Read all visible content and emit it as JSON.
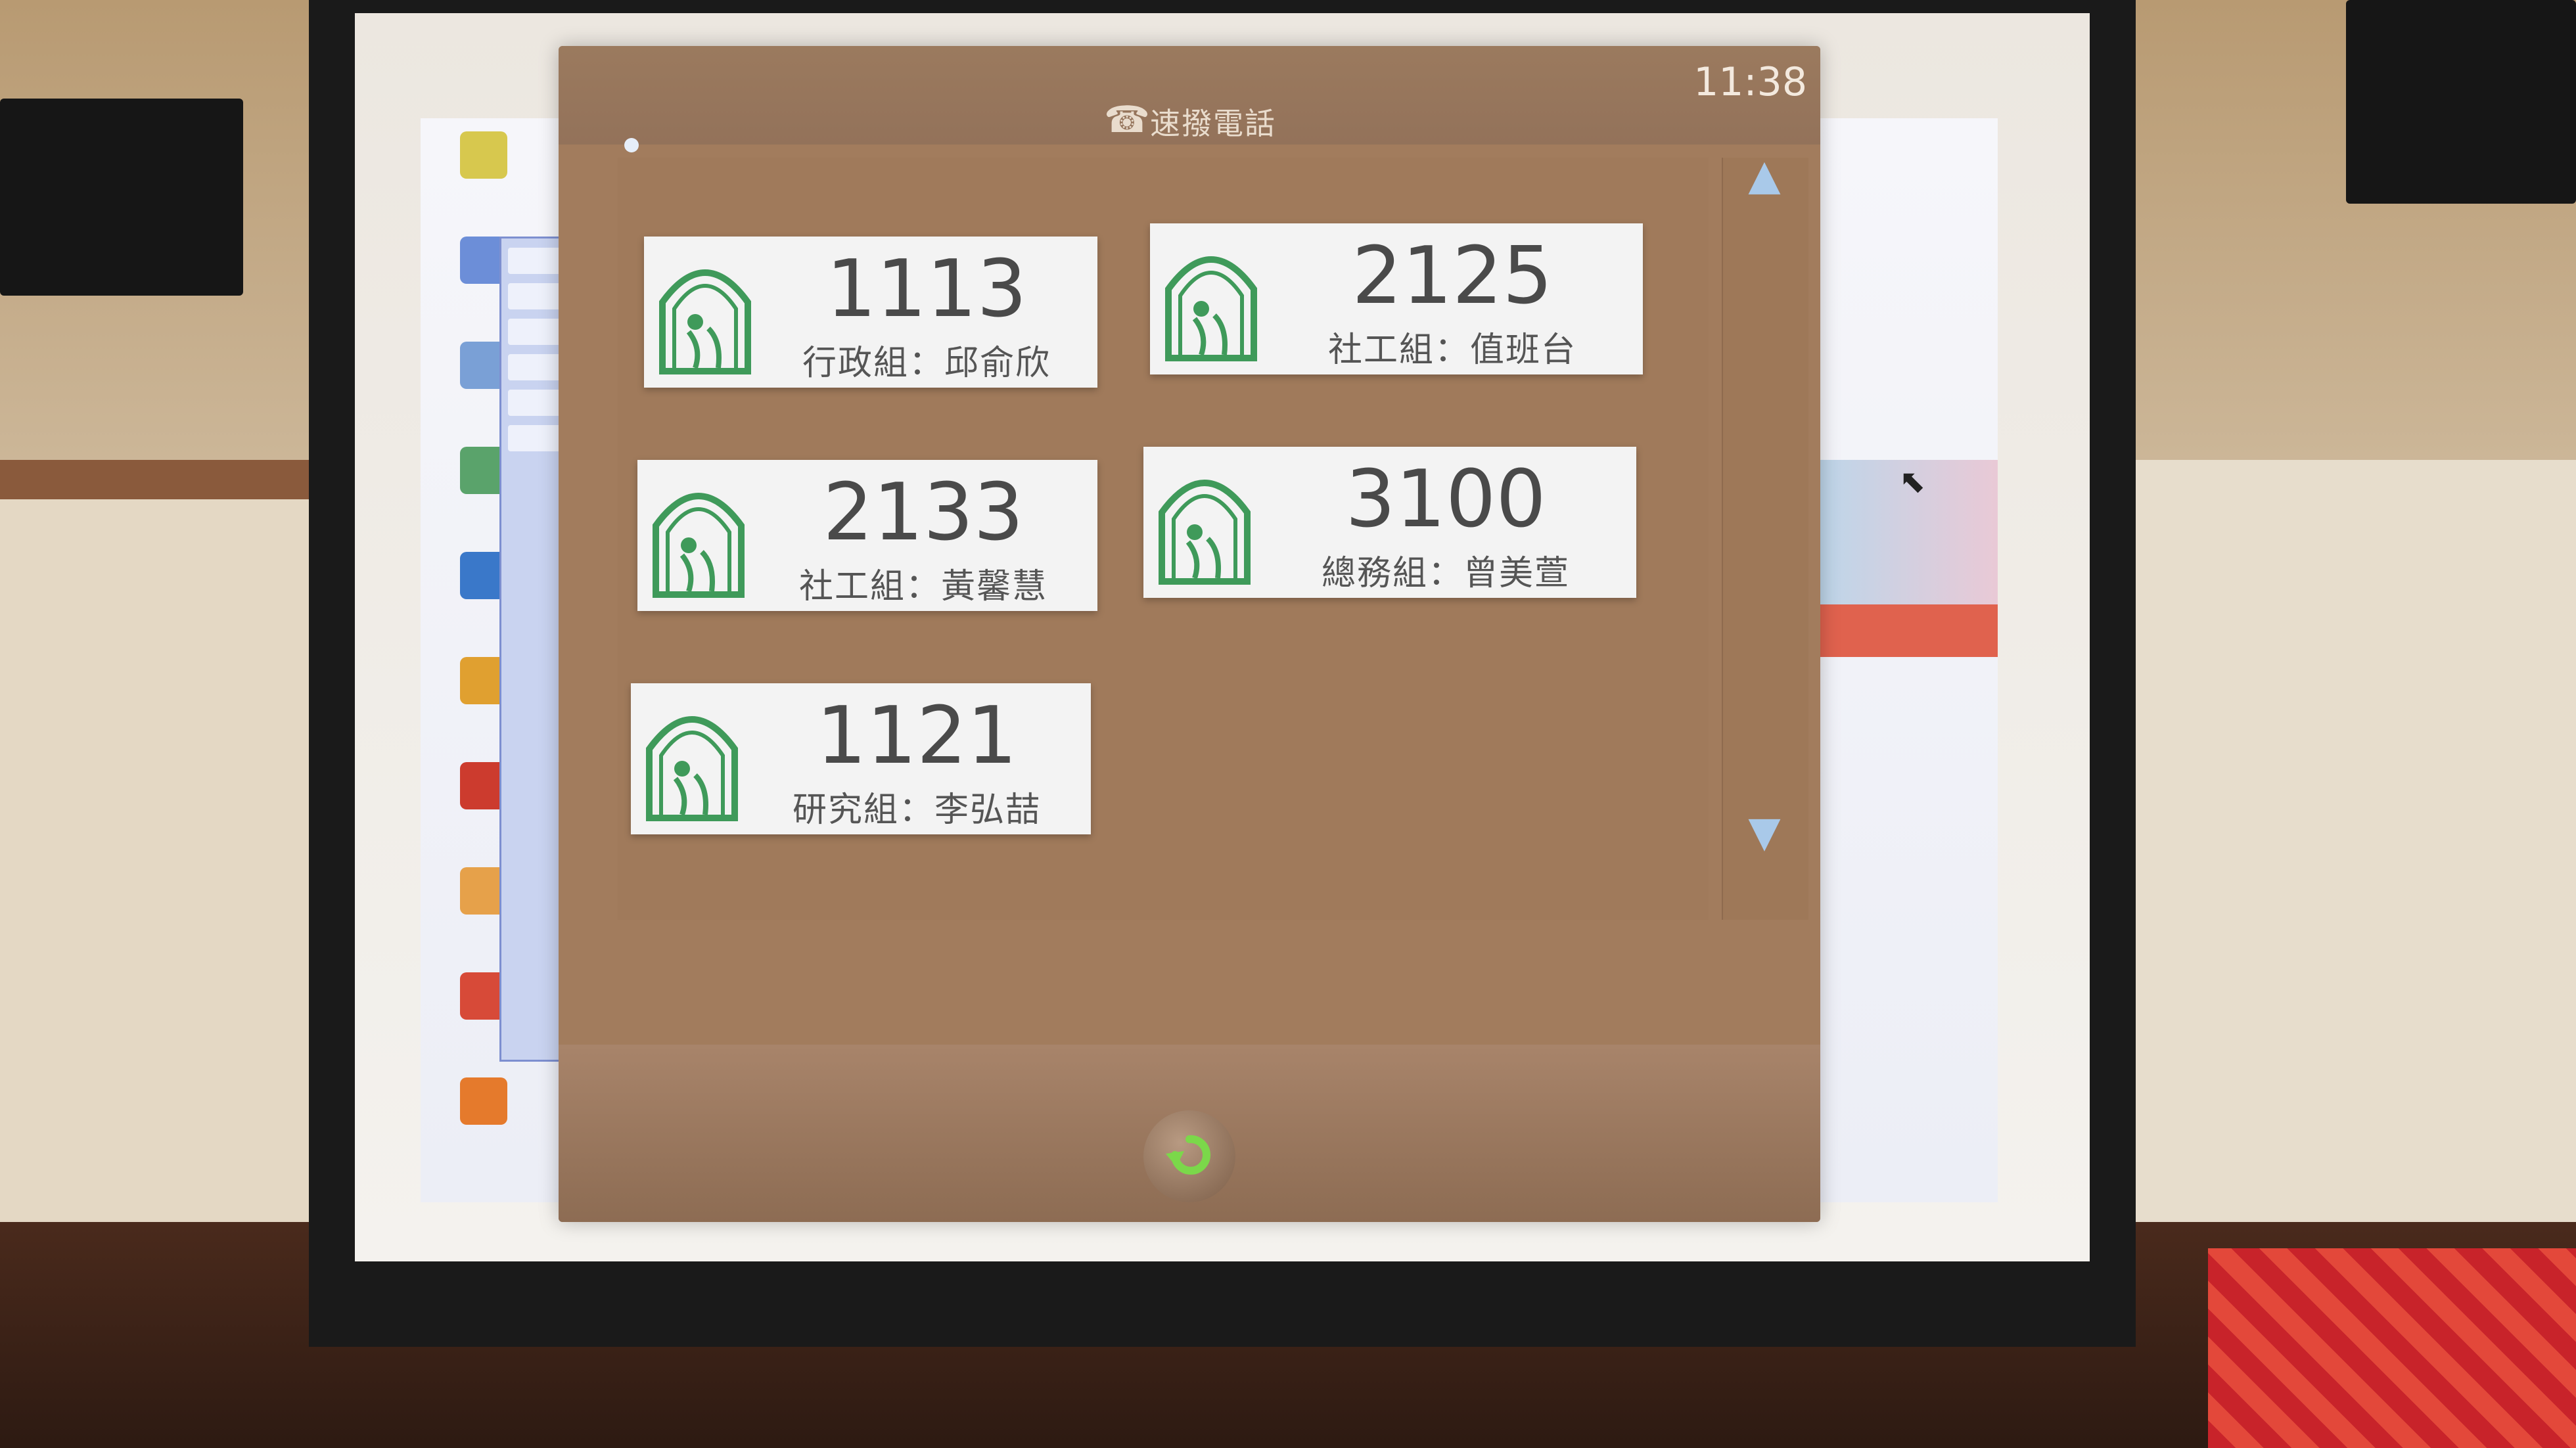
{
  "app": {
    "title": "速撥電話",
    "clock": "11:38"
  },
  "contacts": [
    {
      "ext": "1113",
      "name": "行政組：邱俞欣"
    },
    {
      "ext": "2125",
      "name": "社工組：值班台"
    },
    {
      "ext": "2133",
      "name": "社工組：黃馨慧"
    },
    {
      "ext": "3100",
      "name": "總務組：曾美萱"
    },
    {
      "ext": "1121",
      "name": "研究組：李弘喆"
    }
  ],
  "icons": {
    "title": "phone-icon",
    "back": "refresh-back-icon",
    "scroll_up": "triangle-up-icon",
    "scroll_down": "triangle-down-icon",
    "card_logo": "green-arch-logo-icon"
  },
  "colors": {
    "app_bg": "#a27c5d",
    "card_bg": "#f3f3f3",
    "logo_green": "#3f9a5a",
    "scroll_arrow": "#a9c9e9"
  }
}
